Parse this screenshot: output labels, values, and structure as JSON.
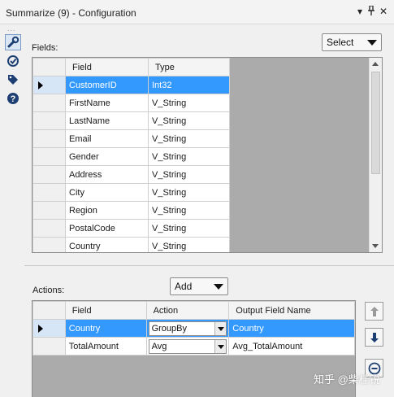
{
  "window": {
    "title": "Summarize (9) - Configuration",
    "pin_glyph": "▾ ‡ ✕"
  },
  "sidebar": {
    "dots": "...",
    "icons": [
      "wrench-icon",
      "target-icon",
      "tag-icon",
      "help-icon"
    ]
  },
  "fields": {
    "label": "Fields:",
    "select_button": "Select",
    "columns": [
      "Field",
      "Type"
    ],
    "rows": [
      {
        "field": "CustomerID",
        "type": "Int32",
        "selected": true
      },
      {
        "field": "FirstName",
        "type": "V_String"
      },
      {
        "field": "LastName",
        "type": "V_String"
      },
      {
        "field": "Email",
        "type": "V_String"
      },
      {
        "field": "Gender",
        "type": "V_String"
      },
      {
        "field": "Address",
        "type": "V_String"
      },
      {
        "field": "City",
        "type": "V_String"
      },
      {
        "field": "Region",
        "type": "V_String"
      },
      {
        "field": "PostalCode",
        "type": "V_String"
      },
      {
        "field": "Country",
        "type": "V_String"
      }
    ]
  },
  "actions": {
    "label": "Actions:",
    "add_button": "Add",
    "columns": [
      "Field",
      "Action",
      "Output Field Name"
    ],
    "rows": [
      {
        "field": "Country",
        "action": "GroupBy",
        "output": "Country",
        "selected": true
      },
      {
        "field": "TotalAmount",
        "action": "Avg",
        "output": "Avg_TotalAmount"
      }
    ]
  },
  "watermark": "知乎 @柴桂锐",
  "colors": {
    "selection": "#3399ff",
    "grid_bg": "#ababab",
    "panel_bg": "#f0f0f0"
  }
}
